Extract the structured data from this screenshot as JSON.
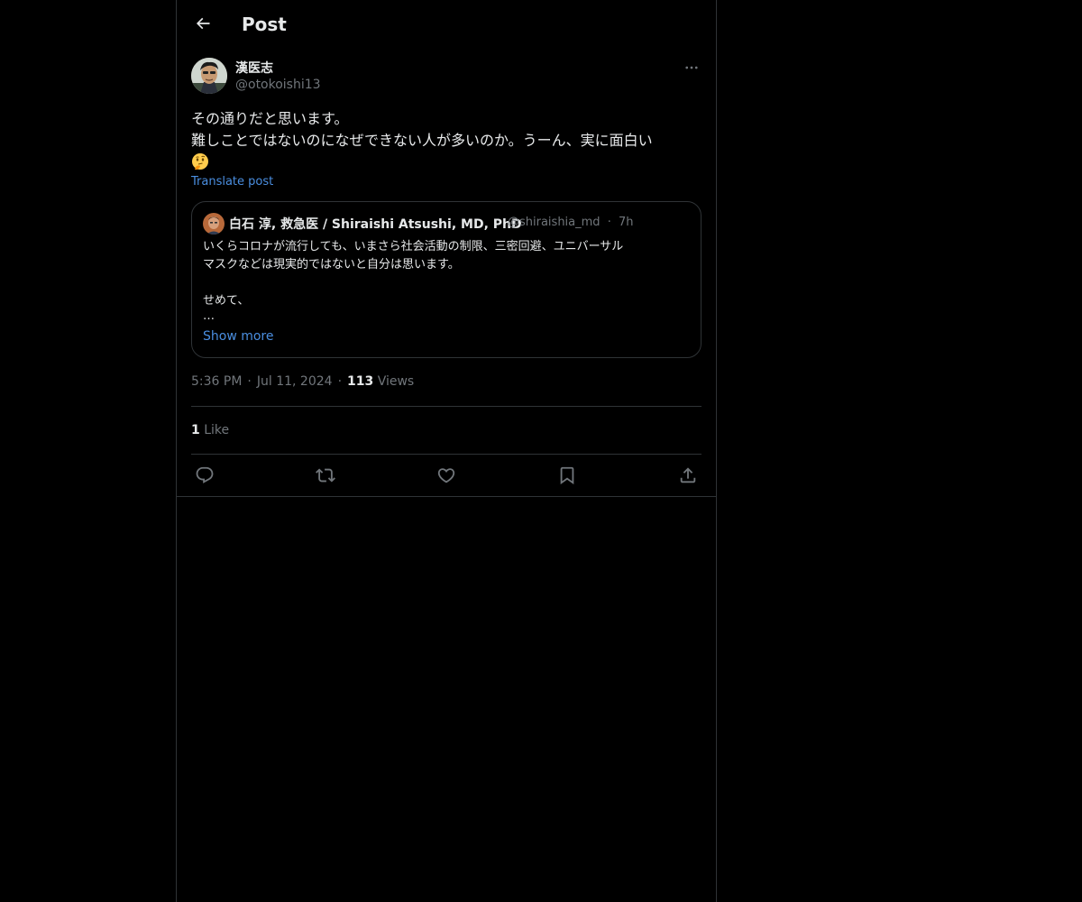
{
  "header": {
    "title": "Post",
    "back_icon": "arrow-left-icon"
  },
  "post": {
    "author": {
      "name": "漢医志",
      "handle": "@otokoishi13"
    },
    "more_icon": "ellipsis-icon",
    "text_lines": [
      "その通りだと思います。",
      "難しことではないのになぜできない人が多いのか。うーん、実に面白い"
    ],
    "emoji": "thinking-face-emoji",
    "translate_label": "Translate post",
    "quote": {
      "author_name": "白石 淳, 救急医 / Shiraishi Atsushi, MD, PhD",
      "handle": "@shiraishia_md",
      "separator": "·",
      "time": "7h",
      "text_lines": [
        "いくらコロナが流行しても、いまさら社会活動の制限、三密回避、ユニバーサル",
        "マスクなどは現実的ではないと自分は思います。",
        "",
        "せめて、",
        "…"
      ],
      "show_more_label": "Show more"
    },
    "meta": {
      "time": "5:36 PM",
      "date": "Jul 11, 2024",
      "views_count": "113",
      "views_label": "Views",
      "separator": "·"
    },
    "likes": {
      "count": "1",
      "label": "Like"
    },
    "actions": [
      {
        "name": "reply",
        "icon": "reply-icon"
      },
      {
        "name": "repost",
        "icon": "repost-icon"
      },
      {
        "name": "like",
        "icon": "heart-icon"
      },
      {
        "name": "bookmark",
        "icon": "bookmark-icon"
      },
      {
        "name": "share",
        "icon": "share-icon"
      }
    ]
  },
  "colors": {
    "background": "#000000",
    "text": "#e7e9ea",
    "secondary_text": "#71767b",
    "link": "#4a8ee0",
    "border": "#2f3336"
  }
}
